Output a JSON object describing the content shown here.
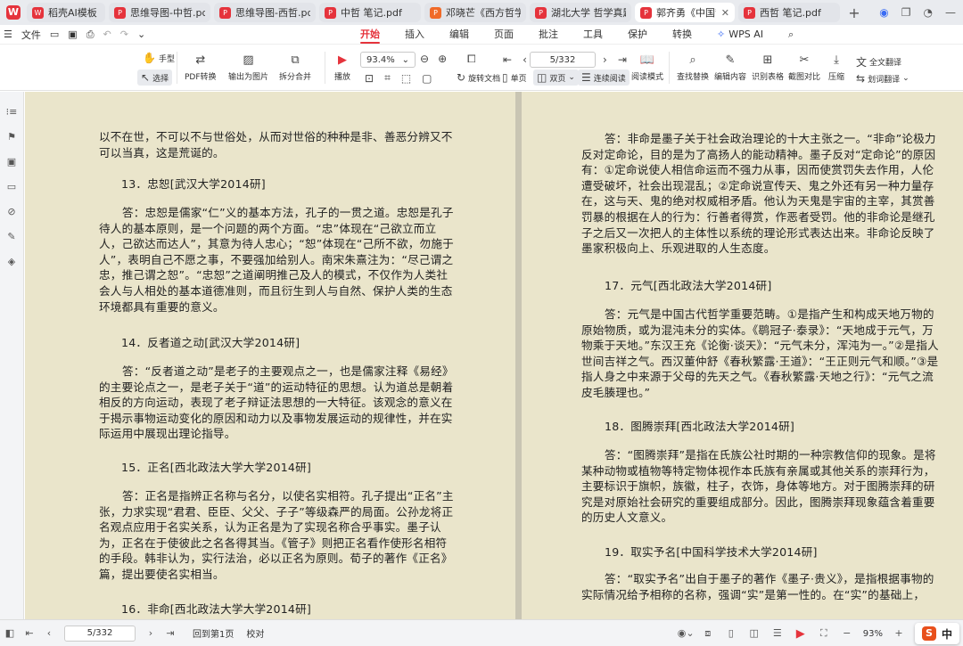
{
  "app": {
    "logo_letter": "W"
  },
  "tabs": [
    {
      "label": "稻壳AI模板",
      "icon": "W",
      "active": false
    },
    {
      "label": "思维导图-中哲.pdf",
      "icon": "P",
      "active": false
    },
    {
      "label": "思维导图-西哲.pdf（E",
      "icon": "P",
      "active": false
    },
    {
      "label": "中哲 笔记.pdf",
      "icon": "P",
      "active": false
    },
    {
      "label": "邓晓芒《西方哲学史》",
      "icon": "P",
      "active": false
    },
    {
      "label": "湖北大学 哲学真题20",
      "icon": "P",
      "active": false
    },
    {
      "label": "郭齐勇《中国哲",
      "icon": "P",
      "active": true
    },
    {
      "label": "西哲 笔记.pdf",
      "icon": "P",
      "active": false
    }
  ],
  "menu": {
    "file_label": "文件",
    "tabs": [
      "开始",
      "插入",
      "编辑",
      "页面",
      "批注",
      "工具",
      "保护",
      "转换"
    ],
    "active_tab": "开始",
    "wps_ai": "WPS AI"
  },
  "toolbar": {
    "hand": "手型",
    "select": "选择",
    "pdf_convert": "PDF转换",
    "export_image": "输出为图片",
    "split_merge": "拆分合并",
    "play": "播放",
    "zoom": "93.4%",
    "page_input": "5/332",
    "rotate": "旋转文档",
    "single": "单页",
    "double": "双页",
    "continuous": "连续阅读",
    "read_mode": "阅读模式",
    "find_replace": "查找替换",
    "edit_content": "编辑内容",
    "ocr_table": "识别表格",
    "screenshot_compare": "截图对比",
    "compress": "压缩",
    "full_translate": "全文翻译",
    "word_translate": "划词翻译"
  },
  "left_page": {
    "blocks": [
      "以不在世，不可以不与世俗处，从而对世俗的种种是非、善恶分辨又不可以当真，这是荒诞的。",
      "13．忠恕[武汉大学2014研]",
      "答：忠恕是儒家“仁”义的基本方法，孔子的一贯之道。忠恕是孔子待人的基本原则，是一个问题的两个方面。“忠”体现在“己欲立而立人，己欲达而达人”，其意为待人忠心；“恕”体现在“己所不欲，勿施于人”，表明自己不愿之事，不要强加给别人。南宋朱熹注为：“尽己谓之忠，推己谓之恕”。“忠恕”之道阐明推己及人的模式，不仅作为人类社会人与人相处的基本道德准则，而且衍生到人与自然、保护人类的生态环境都具有重要的意义。",
      "14．反者道之动[武汉大学2014研]",
      "答：“反者道之动”是老子的主要观点之一，也是儒家注释《易经》的主要论点之一，是老子关于“道”的运动特征的思想。认为道总是朝着相反的方向运动，表现了老子辩证法思想的一大特征。该观念的意义在于揭示事物运动变化的原因和动力以及事物发展运动的规律性，并在实际运用中展现出理论指导。",
      "15．正名[西北政法大学大学2014研]",
      "答：正名是指辨正名称与名分，以使名实相符。孔子提出“正名”主张，力求实现“君君、臣臣、父父、子子”等级森严的局面。公孙龙将正名观点应用于名实关系，认为正名是为了实现名称合乎事实。墨子认为，正名在于使彼此之名各得其当。《管子》则把正名看作使形名相符的手段。韩非认为，实行法治，必以正名为原则。荀子的著作《正名》篇，提出要使名实相当。",
      "16．非命[西北政法大学大学2014研]"
    ]
  },
  "right_page": {
    "blocks": [
      "答：非命是墨子关于社会政治理论的十大主张之一。“非命”论极力反对定命论，目的是为了高扬人的能动精神。墨子反对“定命论”的原因有：①定命说使人相信命运而不强力从事，因而使赏罚失去作用，人伦遭受破坏，社会出现混乱；②定命说宣传天、鬼之外还有另一种力量存在，这与天、鬼的绝对权威相矛盾。他认为天鬼是宇宙的主宰，其赏善罚暴的根据在人的行为：行善者得赏，作恶者受罚。他的非命论是继孔子之后又一次把人的主体性以系统的理论形式表达出来。非命论反映了墨家积极向上、乐观进取的人生态度。",
      "17．元气[西北政法大学2014研]",
      "答：元气是中国古代哲学重要范畴。①是指产生和构成天地万物的原始物质，或为混沌未分的实体。《鹖冠子·泰录》：“天地成于元气，万物乘于天地。”东汉王充《论衡·谈天》：“元气未分，浑沌为一。”②是指人世间吉祥之气。西汉董仲舒《春秋繁露·王道》：“王正则元气和顺。”③是指人身之中来源于父母的先天之气。《春秋繁露·天地之行》：“元气之流皮毛腠理也。”",
      "18．图腾崇拜[西北政法大学2014研]",
      "答：“图腾崇拜”是指在氏族公社时期的一种宗教信仰的现象。是将某种动物或植物等特定物体视作本氏族有亲属或其他关系的崇拜行为，主要标识于旗帜，族徽，柱子，衣饰，身体等地方。对于图腾崇拜的研究是对原始社会研究的重要组成部分。因此，图腾崇拜现象蕴含着重要的历史人文意义。",
      "19．取实予名[中国科学技术大学2014研]",
      "答：“取实予名”出自于墨子的著作《墨子·贵义》，是指根据事物的实际情况给予相称的名称，强调“实”是第一性的。在“实”的基础上，"
    ]
  },
  "status": {
    "page_input": "5/332",
    "back_to_page1": "回到第1页",
    "proofread": "校对",
    "zoom": "93%",
    "ime_letter": "S",
    "ime_lang": "中"
  }
}
